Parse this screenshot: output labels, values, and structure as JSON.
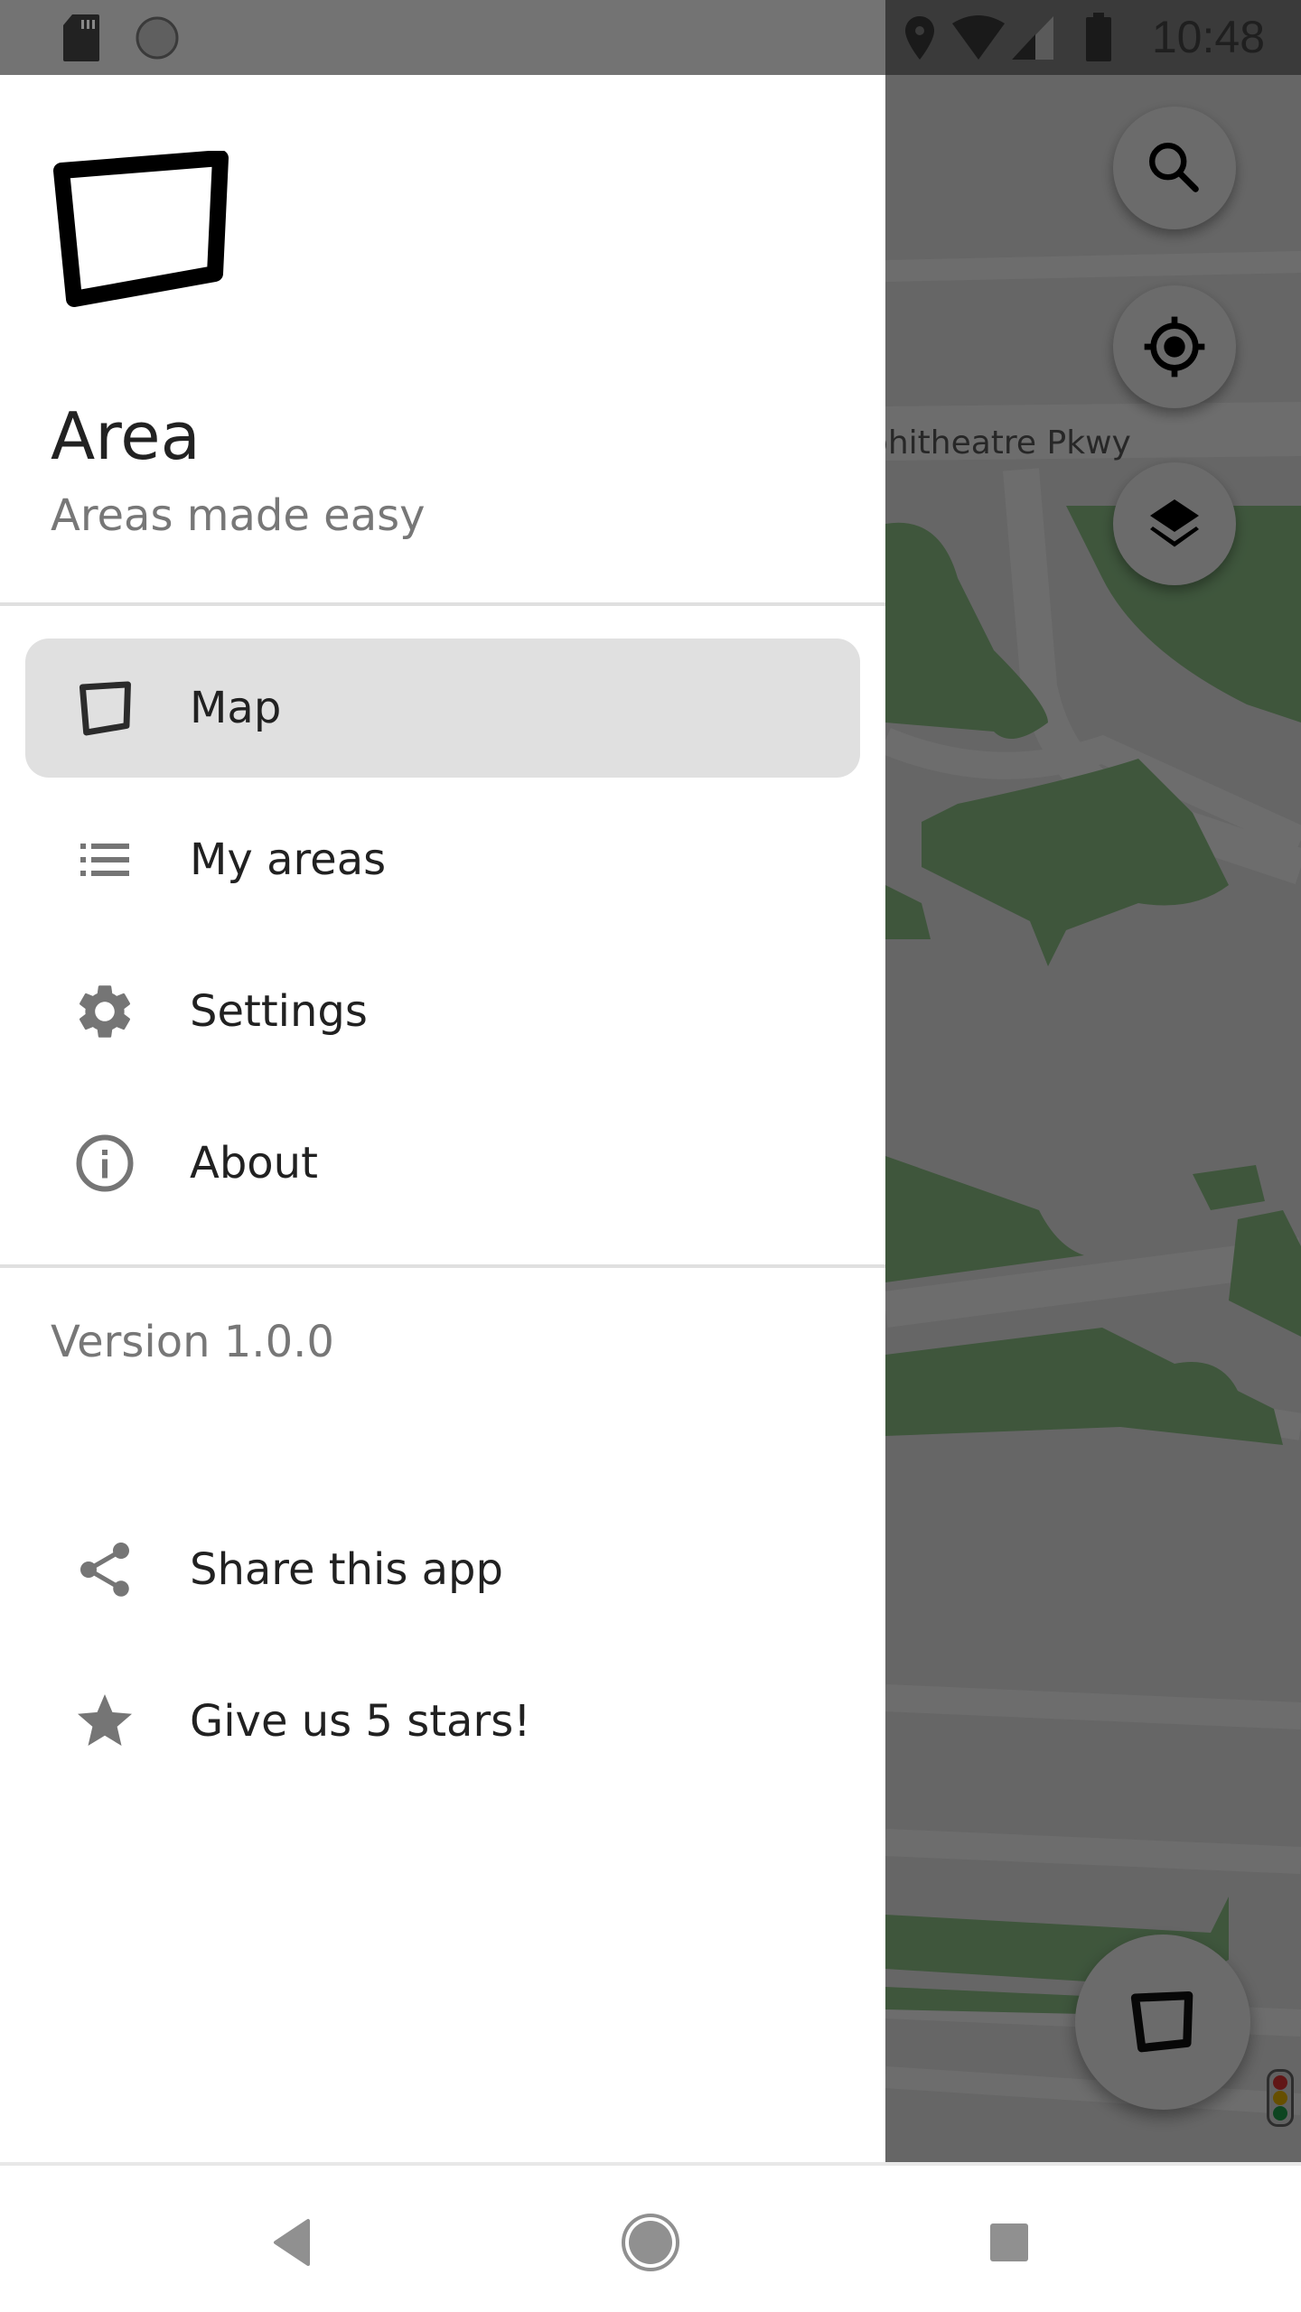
{
  "status_bar": {
    "time": "10:48",
    "left_icons": [
      "sd-card-icon",
      "sync-icon"
    ],
    "right_icons": [
      "location-icon",
      "wifi-icon",
      "cell-signal-icon",
      "battery-icon"
    ]
  },
  "drawer": {
    "app_title": "Area",
    "app_subtitle": "Areas made easy",
    "logo_icon": "area-polygon-icon",
    "items": [
      {
        "label": "Map",
        "icon": "area-polygon-icon",
        "active": true
      },
      {
        "label": "My areas",
        "icon": "list-icon",
        "active": false
      },
      {
        "label": "Settings",
        "icon": "gear-icon",
        "active": false
      },
      {
        "label": "About",
        "icon": "info-icon",
        "active": false
      }
    ],
    "version": "Version 1.0.0",
    "secondary_items": [
      {
        "label": "Share this app",
        "icon": "share-icon"
      },
      {
        "label": "Give us 5 stars!",
        "icon": "star-icon"
      }
    ]
  },
  "map": {
    "street_label": "phitheatre Pkwy",
    "buttons": [
      {
        "name": "search",
        "icon": "search-icon"
      },
      {
        "name": "my-location",
        "icon": "my-location-icon"
      },
      {
        "name": "layers",
        "icon": "layers-icon"
      },
      {
        "name": "draw-area",
        "icon": "area-polygon-icon"
      }
    ],
    "traffic_icon": "traffic-light-icon"
  },
  "nav_bar": {
    "buttons": [
      "back",
      "home",
      "recents"
    ]
  },
  "colors": {
    "drawer_bg": "#ffffff",
    "active_item_bg": "#e0e0e0",
    "icon_gray": "#757575",
    "text_primary": "#212121",
    "text_secondary": "#777777",
    "map_green": "#8fc48a",
    "scrim": "rgba(0,0,0,0.56)"
  }
}
